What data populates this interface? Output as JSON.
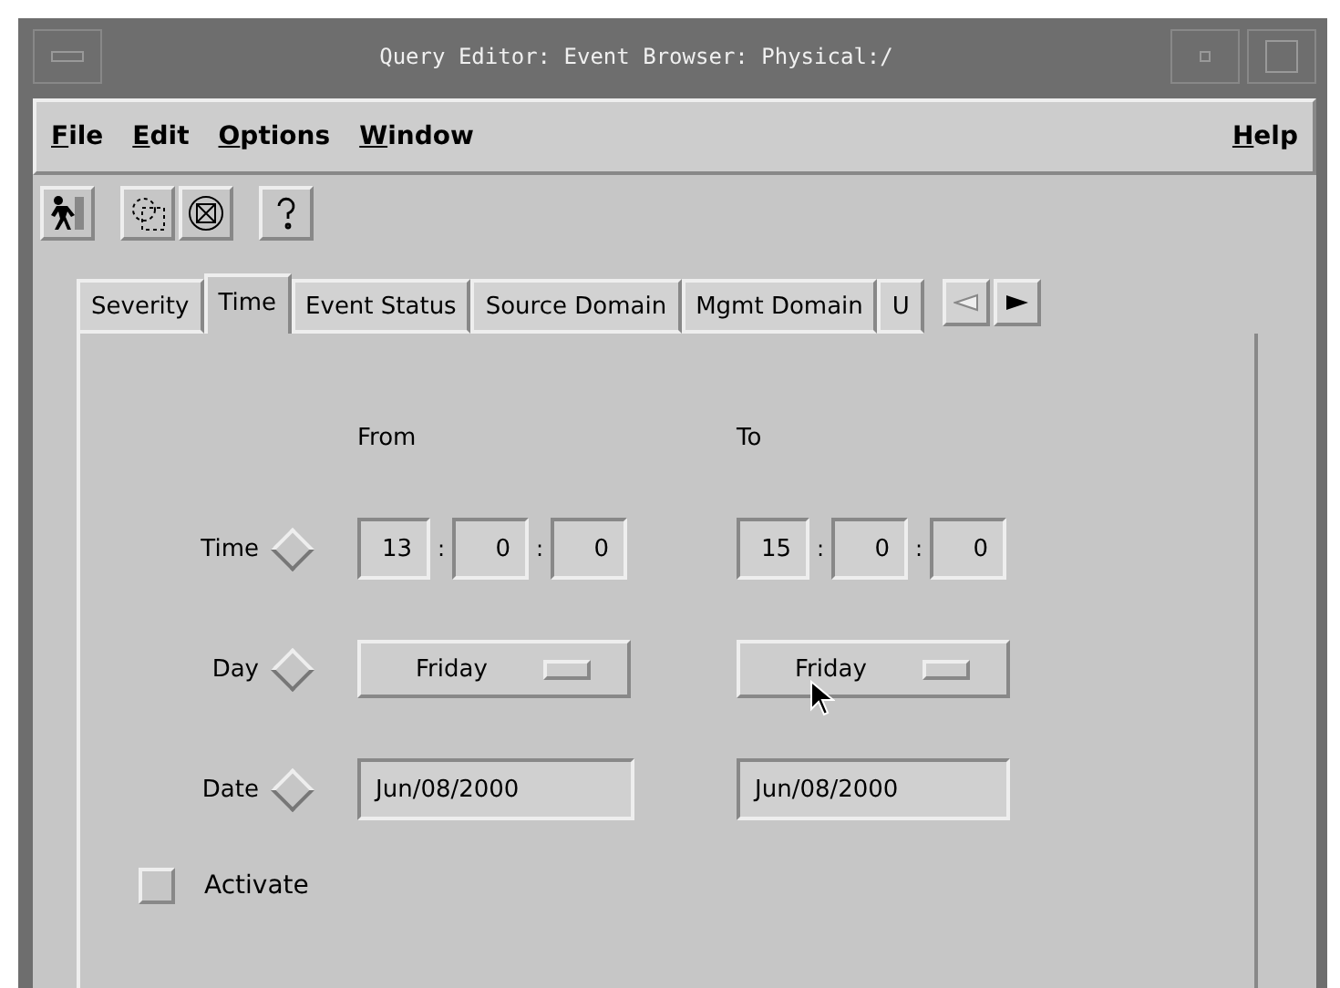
{
  "window": {
    "title": "Query Editor: Event Browser: Physical:/"
  },
  "menu": [
    {
      "label": "File"
    },
    {
      "label": "Edit"
    },
    {
      "label": "Options"
    },
    {
      "label": "Window"
    }
  ],
  "help_menu": {
    "label": "Help"
  },
  "toolbar": [
    {
      "kind": "exit"
    },
    {
      "kind": "select"
    },
    {
      "kind": "clear"
    },
    {
      "kind": "help"
    }
  ],
  "tabs": [
    {
      "label": "Severity",
      "selected": false
    },
    {
      "label": "Time",
      "selected": true
    },
    {
      "label": "Event Status",
      "selected": false
    },
    {
      "label": "Source Domain",
      "selected": false
    },
    {
      "label": "Mgmt Domain",
      "selected": false
    },
    {
      "label": "U",
      "selected": false
    }
  ],
  "columns": {
    "from": "From",
    "to": "To"
  },
  "rows": [
    {
      "kind": "time",
      "label": "Time",
      "selected": false,
      "from": [
        "13",
        "0",
        "0"
      ],
      "to": [
        "15",
        "0",
        "0"
      ],
      "separator": ":"
    },
    {
      "kind": "day",
      "label": "Day",
      "selected": false,
      "from": "Friday",
      "to": "Friday"
    },
    {
      "kind": "date",
      "label": "Date",
      "selected": false,
      "from": "Jun/08/2000",
      "to": "Jun/08/2000"
    }
  ],
  "activate": {
    "label": "Activate",
    "checked": false
  }
}
